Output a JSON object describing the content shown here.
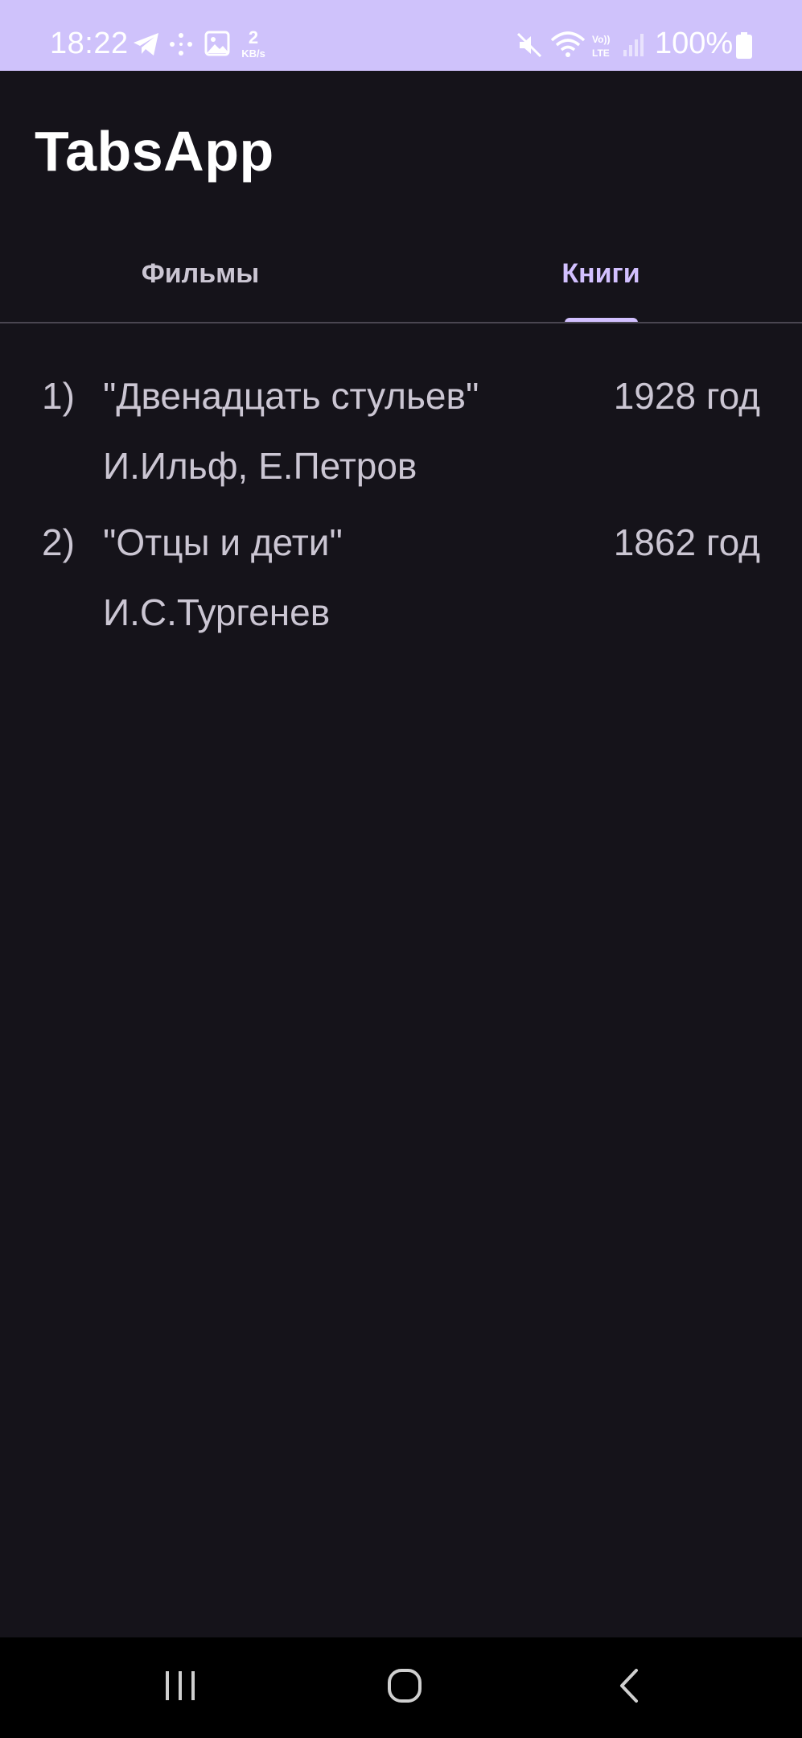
{
  "status_bar": {
    "time": "18:22",
    "speed_value": "2",
    "speed_unit": "KB/s",
    "battery": "100%",
    "icons": [
      "telegram-icon",
      "dots-icon",
      "gallery-icon",
      "mute-icon",
      "wifi-icon",
      "volte-icon",
      "signal-icon",
      "battery-icon"
    ]
  },
  "app": {
    "title": "TabsApp"
  },
  "tabs": [
    {
      "label": "Фильмы",
      "selected": false
    },
    {
      "label": "Книги",
      "selected": true
    }
  ],
  "books": [
    {
      "number": "1)",
      "title": "\"Двенадцать стульев\"",
      "year": "1928 год",
      "author": "И.Ильф, Е.Петров"
    },
    {
      "number": "2)",
      "title": "\"Отцы и дети\"",
      "year": "1862 год",
      "author": "И.С.Тургенев"
    }
  ],
  "nav_bar": {
    "buttons": [
      "recents-icon",
      "home-icon",
      "back-icon"
    ]
  },
  "colors": {
    "status_bar_bg": "#cfc2fb",
    "background": "#15131a",
    "accent": "#d2c0ff",
    "text": "#cbc6d3"
  }
}
